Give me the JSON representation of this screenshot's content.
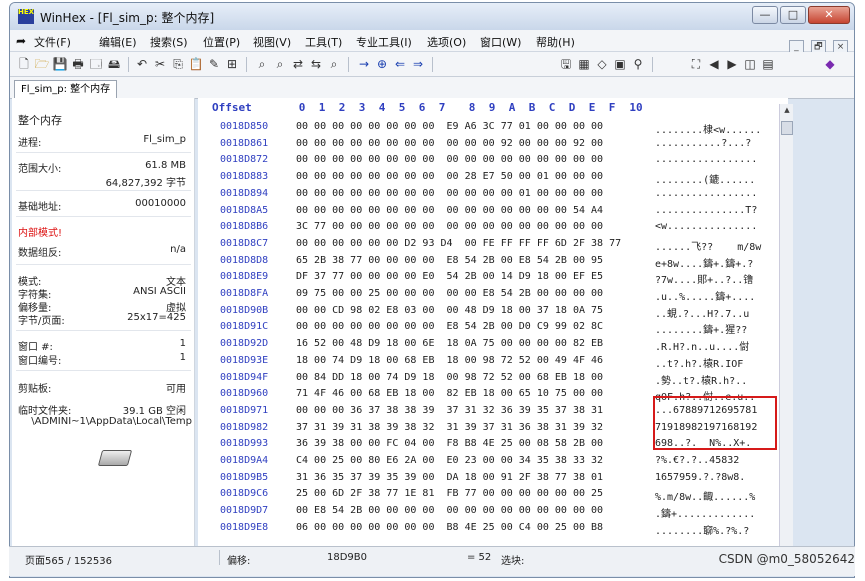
{
  "window": {
    "title": "WinHex - [Fl_sim_p: 整个内存]",
    "icon_text": "HEX"
  },
  "controls": {
    "minimize": "—",
    "maximize": "□",
    "close": "✕"
  },
  "menu": [
    {
      "label": "文件(F)",
      "icon": "arrow-icon"
    },
    {
      "label": "编辑(E)"
    },
    {
      "label": "搜索(S)"
    },
    {
      "label": "位置(P)"
    },
    {
      "label": "视图(V)"
    },
    {
      "label": "工具(T)"
    },
    {
      "label": "专业工具(I)"
    },
    {
      "label": "选项(O)"
    },
    {
      "label": "窗口(W)"
    },
    {
      "label": "帮助(H)"
    }
  ],
  "mdi_controls": [
    "_",
    "🗗",
    "×"
  ],
  "tab": {
    "label": "Fl_sim_p: 整个内存"
  },
  "panel": {
    "heading": "整个内存",
    "process_label": "进程:",
    "process_value": "Fl_sim_p",
    "range_label": "范围大小:",
    "range_value1": "61.8 MB",
    "range_value2": "64,827,392 字节",
    "base_label": "基础地址:",
    "base_value": "00010000",
    "internal_mode": "内部模式!",
    "datagroup_label": "数据组反:",
    "datagroup_value": "n/a",
    "mode_label": "模式:",
    "mode_value": "文本",
    "charset_label": "字符集:",
    "charset_value": "ANSI ASCII",
    "offset_label": "偏移量:",
    "offset_value": "虚拟",
    "bpp_label": "字节/页面:",
    "bpp_value": "25x17=425",
    "window_no_label": "窗口 #:",
    "window_no_value": "1",
    "window_count_label": "窗口编号:",
    "window_count_value": "1",
    "clipboard_label": "剪贴板:",
    "clipboard_value": "可用",
    "temp_label": "临时文件夹:",
    "temp_value": "39.1 GB 空闲",
    "temp_path": "\\ADMINI~1\\AppData\\Local\\Temp"
  },
  "hex": {
    "offset_header": "Offset",
    "columns": [
      "0",
      "1",
      "2",
      "3",
      "4",
      "5",
      "6",
      "7",
      "8",
      "9",
      "A",
      "B",
      "C",
      "D",
      "E",
      "F",
      "10"
    ],
    "rows": [
      {
        "offset": "0018D850",
        "hex": "00 00 00 00 00 00 00 00  E9 A6 3C 77 01 00 00 00 00",
        "ascii": "........棣<w......"
      },
      {
        "offset": "0018D861",
        "hex": "00 00 00 00 00 00 00 00  00 00 00 92 00 00 00 92 00",
        "ascii": "...........?...?"
      },
      {
        "offset": "0018D872",
        "hex": "00 00 00 00 00 00 00 00  00 00 00 00 00 00 00 00 00",
        "ascii": "................."
      },
      {
        "offset": "0018D883",
        "hex": "00 00 00 00 00 00 00 00  00 28 E7 50 00 01 00 00 00",
        "ascii": "........(鏕......"
      },
      {
        "offset": "0018D894",
        "hex": "00 00 00 00 00 00 00 00  00 00 00 00 01 00 00 00 00",
        "ascii": "................."
      },
      {
        "offset": "0018D8A5",
        "hex": "00 00 00 00 00 00 00 00  00 00 00 00 00 00 00 54 A4",
        "ascii": "...............T?"
      },
      {
        "offset": "0018D8B6",
        "hex": "3C 77 00 00 00 00 00 00  00 00 00 00 00 00 00 00 00",
        "ascii": "<w..............."
      },
      {
        "offset": "0018D8C7",
        "hex": "00 00 00 00 00 00 D2 93 D4  00 FE FF FF FF 6D 2F 38 77",
        "ascii": "......飞??    m/8w"
      },
      {
        "offset": "0018D8D8",
        "hex": "65 2B 38 77 00 00 00 00  E8 54 2B 00 E8 54 2B 00 95",
        "ascii": "e+8w....鑄+.鑄+.?"
      },
      {
        "offset": "0018D8E9",
        "hex": "DF 37 77 00 00 00 00 E0  54 2B 00 14 D9 18 00 EF E5",
        "ascii": "?7w....郥+..?..镥"
      },
      {
        "offset": "0018D8FA",
        "hex": "09 75 00 00 25 00 00 00  00 00 E8 54 2B 00 00 00 00",
        "ascii": ".u..%.....鑄+...."
      },
      {
        "offset": "0018D90B",
        "hex": "00 00 CD 98 02 E8 03 00  00 48 D9 18 00 37 18 0A 75",
        "ascii": "..蜆.?...H?.7..u"
      },
      {
        "offset": "0018D91C",
        "hex": "00 00 00 00 00 00 00 00  E8 54 2B 00 D0 C9 99 02 8C",
        "ascii": "........鑄+.猩??"
      },
      {
        "offset": "0018D92D",
        "hex": "16 52 00 48 D9 18 00 6E  18 0A 75 00 00 00 00 82 EB",
        "ascii": ".R.H?.n..u....傠"
      },
      {
        "offset": "0018D93E",
        "hex": "18 00 74 D9 18 00 68 EB  18 00 98 72 52 00 49 4F 46",
        "ascii": "..t?.h?.榬R.IOF"
      },
      {
        "offset": "0018D94F",
        "hex": "00 84 DD 18 00 74 D9 18  00 98 72 52 00 68 EB 18 00",
        "ascii": ".勢..t?.榬R.h?.."
      },
      {
        "offset": "0018D960",
        "hex": "71 4F 46 00 68 EB 18 00  82 EB 18 00 65 10 75 00 00",
        "ascii": "qOF.h?..傠..e.u.."
      },
      {
        "offset": "0018D971",
        "hex": "00 00 00 36 37 38 38 39  37 31 32 36 39 35 37 38 31",
        "ascii": "...67889712695781"
      },
      {
        "offset": "0018D982",
        "hex": "37 31 39 31 38 39 38 32  31 39 37 31 36 38 31 39 32",
        "ascii": "71918982197168192"
      },
      {
        "offset": "0018D993",
        "hex": "36 39 38 00 00 FC 04 00  F8 B8 4E 25 00 08 58 2B 00",
        "ascii": "698..?.  N%..X+."
      },
      {
        "offset": "0018D9A4",
        "hex": "C4 00 25 00 80 E6 2A 00  E0 23 00 00 34 35 38 33 32",
        "ascii": "?%.€?.?..45832"
      },
      {
        "offset": "0018D9B5",
        "hex": "31 36 35 37 39 35 39 00  DA 18 00 91 2F 38 77 38 01",
        "ascii": "1657959.?.?8w8."
      },
      {
        "offset": "0018D9C6",
        "hex": "25 00 6D 2F 38 77 1E 81  FB 77 00 00 00 00 00 00 25",
        "ascii": "%.m/8w..齱......%"
      },
      {
        "offset": "0018D9D7",
        "hex": "00 E8 54 2B 00 00 00 00  00 00 00 00 00 00 00 00 00",
        "ascii": ".鑄+............."
      },
      {
        "offset": "0018D9E8",
        "hex": "06 00 00 00 00 00 00 00  B8 4E 25 00 C4 00 25 00 B8",
        "ascii": "........窷%.?%.?"
      }
    ]
  },
  "status": {
    "page": "页面565 / 152536",
    "offset_label": "偏移:",
    "offset_value": "18D9B0",
    "value": "= 52",
    "select_label": "选块:"
  },
  "watermark": "CSDN @m0_58052642"
}
